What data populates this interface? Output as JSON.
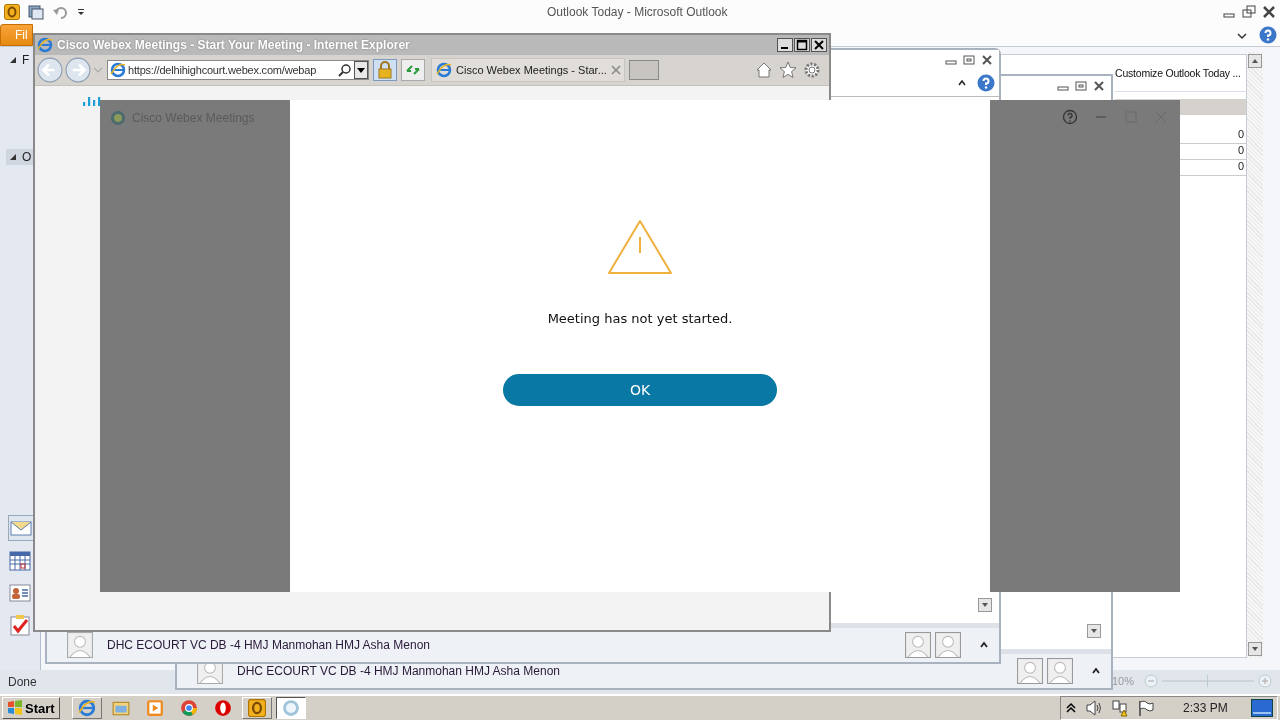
{
  "outlook": {
    "title": "Outlook Today - Microsoft Outlook",
    "file_tab": "Fil",
    "nav_items": [
      "F",
      "O"
    ],
    "customize_link": "Customize Outlook Today ...",
    "counts": [
      "0",
      "0",
      "0"
    ],
    "status": "Done",
    "zoom": "10%"
  },
  "reminder_windows": [
    {
      "subject": "DHC ECOURT VC DB -4 HMJ Manmohan HMJ Asha Menon"
    },
    {
      "subject": "DHC ECOURT VC DB -4 HMJ Manmohan HMJ Asha Menon"
    }
  ],
  "browser": {
    "title": "Cisco Webex Meetings - Start Your Meeting - Internet Explorer",
    "url": "https://delhihighcourt.webex.com/webap",
    "tab_title": "Cisco Webex Meetings - Star..."
  },
  "webex": {
    "title": "Cisco Webex Meetings",
    "message": "Meeting has not yet started.",
    "button": "OK"
  },
  "taskbar": {
    "start": "Start",
    "clock": "2:33 PM",
    "apps": [
      {
        "kind": "ie",
        "selected": false
      },
      {
        "kind": "folder",
        "selected": false
      },
      {
        "kind": "media",
        "selected": false
      },
      {
        "kind": "chrome",
        "selected": false
      },
      {
        "kind": "opera",
        "selected": false
      },
      {
        "kind": "outlook",
        "selected": false
      },
      {
        "kind": "webex",
        "selected": true
      }
    ]
  }
}
